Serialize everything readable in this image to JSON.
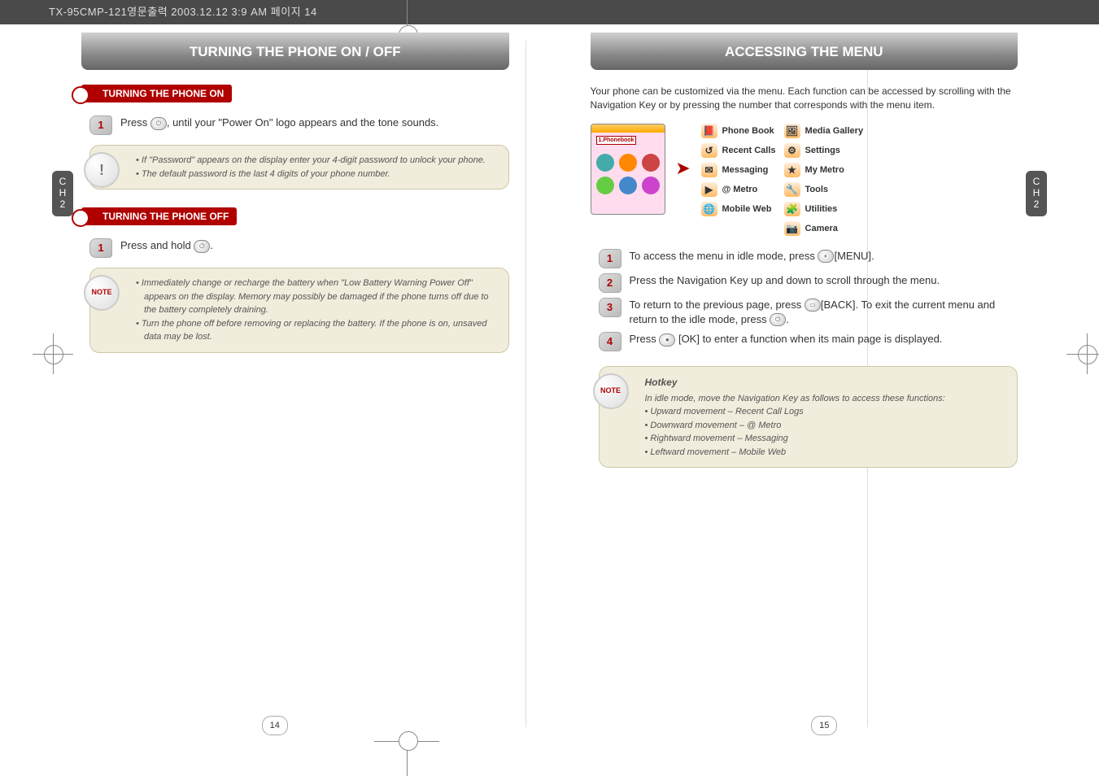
{
  "header": "TX-95CMP-121영문출력  2003.12.12 3:9 AM  페이지 14",
  "left": {
    "title": "TURNING THE PHONE ON / OFF",
    "chapter": "C\nH\n2",
    "section_on": {
      "heading": "TURNING THE PHONE ON",
      "step1": "Press       , until your \"Power On\" logo appears and the tone sounds.",
      "note1_b1": "If \"Password\" appears on the display enter your 4-digit password to unlock your phone.",
      "note1_b2": "The default password is the last 4 digits of your phone number."
    },
    "section_off": {
      "heading": "TURNING THE PHONE OFF",
      "step1": "Press and hold       .",
      "note2_b1": "Immediately change or recharge the battery when \"Low Battery Warning Power Off\" appears on the display. Memory may possibly be damaged if the phone turns off due to the battery completely draining.",
      "note2_b2": "Turn the phone off before removing or replacing the battery. If the phone is on, unsaved data may be lost."
    },
    "page_number": "14"
  },
  "right": {
    "title": "ACCESSING THE MENU",
    "chapter": "C\nH\n2",
    "intro": "Your phone can be customized via the menu. Each function can be accessed by scrolling with the Navigation Key or by pressing the number that corresponds with the menu item.",
    "phone_label": "1.Phonebook",
    "menu_col1": [
      {
        "icon": "📕",
        "label": "Phone Book"
      },
      {
        "icon": "↺",
        "label": "Recent Calls"
      },
      {
        "icon": "✉",
        "label": "Messaging"
      },
      {
        "icon": "▶",
        "label": "@ Metro"
      },
      {
        "icon": "🌐",
        "label": "Mobile Web"
      }
    ],
    "menu_col2": [
      {
        "icon": "🖼",
        "label": "Media Gallery"
      },
      {
        "icon": "⚙",
        "label": "Settings"
      },
      {
        "icon": "★",
        "label": "My Metro"
      },
      {
        "icon": "🔧",
        "label": "Tools"
      },
      {
        "icon": "🧩",
        "label": "Utilities"
      },
      {
        "icon": "📷",
        "label": "Camera"
      }
    ],
    "step1": "To access the menu in idle mode, press      [MENU].",
    "step2": "Press the Navigation Key up and down to scroll through the menu.",
    "step3": "To return to the previous page, press       [BACK]. To exit the current menu and return to the idle mode, press       .",
    "step4": "Press      [OK] to enter a function when its main page is displayed.",
    "hotkey": {
      "title": "Hotkey",
      "intro": "In idle mode, move the Navigation Key as follows to access these functions:",
      "b1": "Upward movement – Recent Call Logs",
      "b2": "Downward movement – @ Metro",
      "b3": "Rightward movement – Messaging",
      "b4": "Leftward movement – Mobile Web"
    },
    "page_number": "15"
  }
}
